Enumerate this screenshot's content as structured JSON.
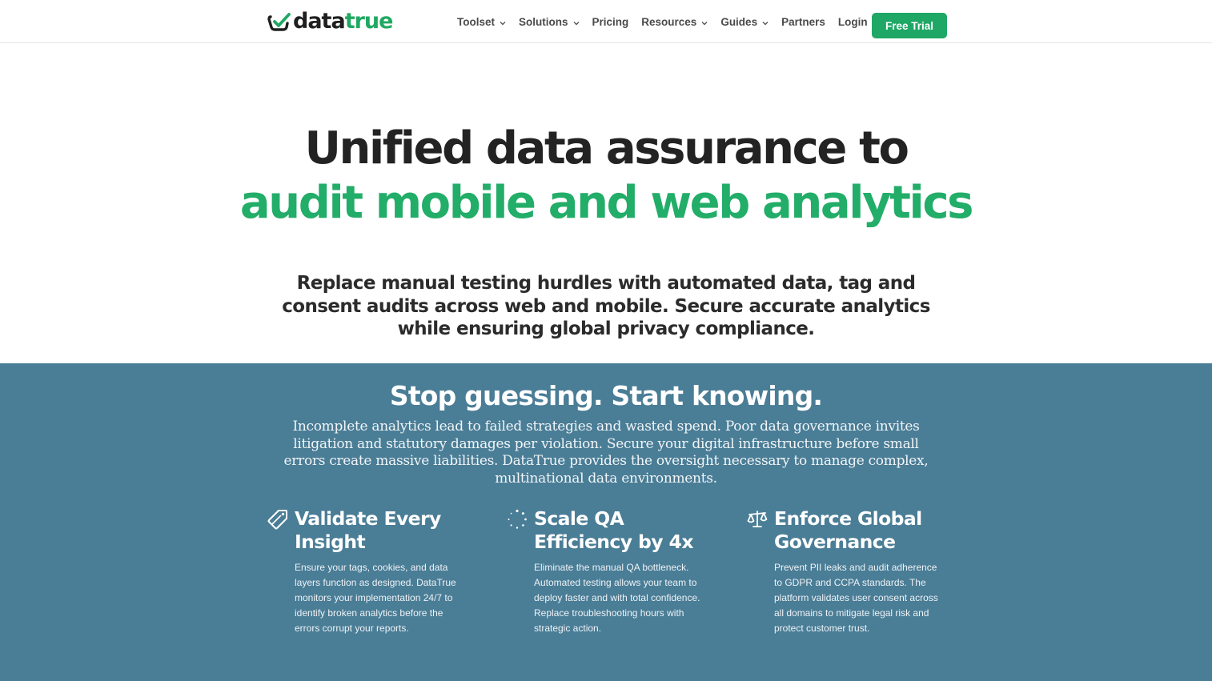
{
  "brand": {
    "name_dark": "data",
    "name_green": "true",
    "primary_color": "#20a862",
    "logo_icon": "checkmark-badge-icon"
  },
  "nav": {
    "items": [
      {
        "label": "Toolset",
        "dropdown": true
      },
      {
        "label": "Solutions",
        "dropdown": true
      },
      {
        "label": "Pricing",
        "dropdown": false
      },
      {
        "label": "Resources",
        "dropdown": true
      },
      {
        "label": "Guides",
        "dropdown": true
      },
      {
        "label": "Partners",
        "dropdown": false
      },
      {
        "label": "Login",
        "icon": "person-icon"
      }
    ],
    "cta_label": "Free Trial"
  },
  "hero": {
    "title_line1": "Unified data assurance to",
    "title_line2": "audit mobile and web analytics",
    "subtitle": "Replace manual testing hurdles with automated data, tag and consent audits across web and mobile. Secure accurate analytics while ensuring global privacy compliance."
  },
  "section": {
    "background_color": "#4a7d96",
    "title": "Stop guessing. Start knowing.",
    "description": "Incomplete analytics lead to failed strategies and wasted spend. Poor data governance invites litigation and statutory damages per violation. Secure your digital infrastructure before small errors create massive liabilities. DataTrue provides the oversight necessary to manage complex, multinational data environments.",
    "features": [
      {
        "icon": "tag-icon",
        "title": "Validate Every Insight",
        "text": "Ensure your tags, cookies, and data layers function as designed. DataTrue monitors your implementation 24/7 to identify broken analytics before the errors corrupt your reports."
      },
      {
        "icon": "spinner-icon",
        "title": "Scale QA Efficiency by 4x",
        "text": "Eliminate the manual QA bottleneck. Automated testing allows your team to deploy faster and with total confidence. Replace troubleshooting hours with strategic action."
      },
      {
        "icon": "balance-scale-icon",
        "title": "Enforce Global Governance",
        "text": "Prevent PII leaks and audit adherence to GDPR and CCPA standards. The platform validates user consent across all domains to mitigate legal risk and protect customer trust."
      }
    ]
  }
}
